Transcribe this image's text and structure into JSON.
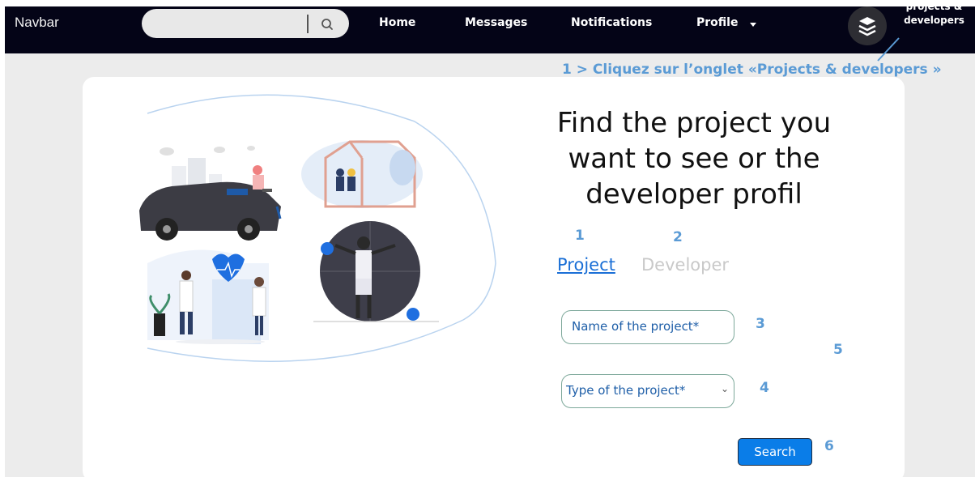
{
  "navbar": {
    "brand": "Navbar",
    "search": {
      "placeholder": "",
      "icon": "search-icon"
    },
    "links": {
      "home": "Home",
      "messages": "Messages",
      "notifications": "Notifications",
      "profile": "Profile"
    },
    "projects_developers": {
      "line1": "projects &",
      "line2": "developers",
      "icon": "layers-icon"
    }
  },
  "annotations": {
    "title": "1 > Cliquez sur l’onglet «Projects & developers »",
    "n1": "1",
    "n2": "2",
    "n3": "3",
    "n4": "4",
    "n5": "5",
    "n6": "6",
    "color": "#5b9bd5"
  },
  "main": {
    "heading_line1": "Find the project you",
    "heading_line2": "want to see or the",
    "heading_line3": "developer profil",
    "tabs": {
      "project": "Project",
      "developer": "Developer"
    },
    "fields": {
      "name_placeholder": "Name of the project*",
      "type_selected": "Type of the project*"
    },
    "search_button": "Search"
  },
  "colors": {
    "navbar_bg": "#040417",
    "accent_blue": "#0a7de8",
    "annotation_blue": "#5b9bd5",
    "page_bg": "#ececec"
  }
}
